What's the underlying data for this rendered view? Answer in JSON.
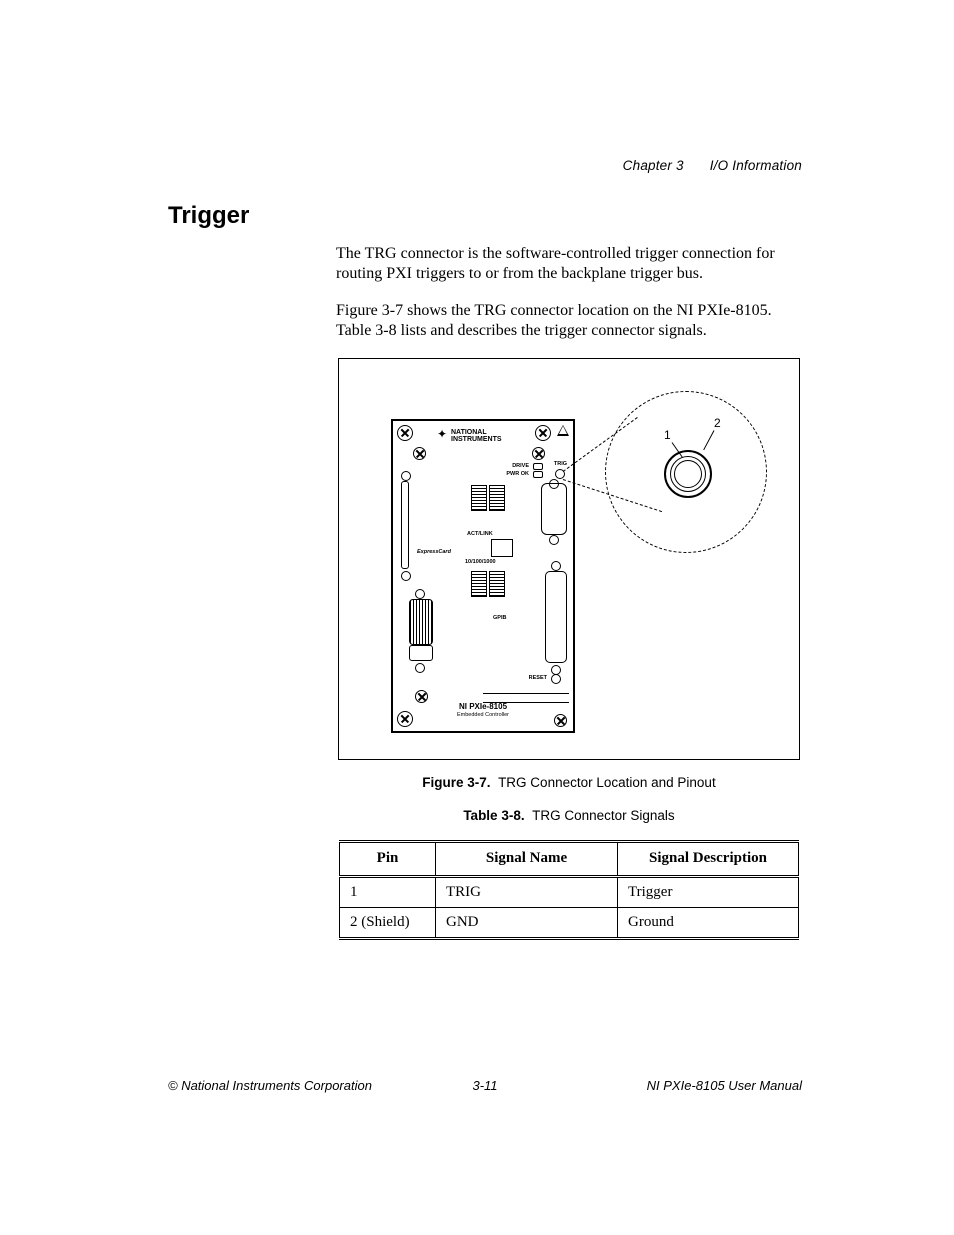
{
  "header": {
    "chapter": "Chapter 3",
    "section": "I/O Information"
  },
  "title": "Trigger",
  "paragraphs": {
    "p1": "The TRG connector is the software-controlled trigger connection for routing PXI triggers to or from the backplane trigger bus.",
    "p2": "Figure 3-7 shows the TRG connector location on the NI PXIe-8105. Table 3-8 lists and describes the trigger connector signals."
  },
  "figure": {
    "label": "Figure 3-7.",
    "caption": "TRG Connector Location and Pinout",
    "callouts": {
      "one": "1",
      "two": "2"
    },
    "panel": {
      "brand": "NATIONAL INSTRUMENTS",
      "drive": "DRIVE",
      "pwrok": "PWR OK",
      "actlink": "ACT/LINK",
      "speed": "10/100/1000",
      "gpib": "GPIB",
      "reset": "RESET",
      "trig": "TRIG",
      "express": "ExpressCard",
      "product": "NI PXIe-8105",
      "subtitle": "Embedded Controller"
    }
  },
  "table": {
    "label": "Table 3-8.",
    "caption": "TRG Connector Signals",
    "headers": {
      "pin": "Pin",
      "name": "Signal Name",
      "desc": "Signal Description"
    },
    "rows": [
      {
        "pin": "1",
        "name": "TRIG",
        "desc": "Trigger"
      },
      {
        "pin": "2 (Shield)",
        "name": "GND",
        "desc": "Ground"
      }
    ]
  },
  "footer": {
    "left": "© National Instruments Corporation",
    "center": "3-11",
    "right": "NI PXIe-8105 User Manual"
  }
}
